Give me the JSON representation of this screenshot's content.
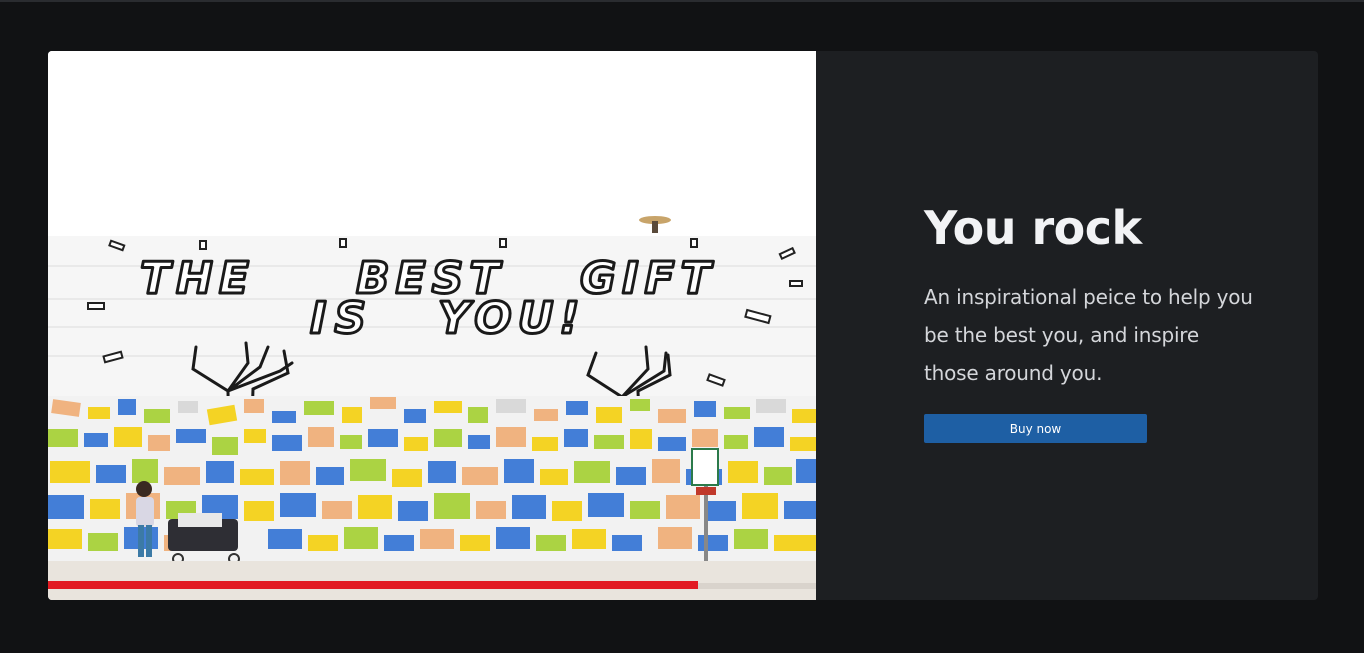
{
  "hero": {
    "image_alt": "Mural reading THE BEST GIFT IS YOU!",
    "mural_text": "THE BEST GIFT IS YOU!"
  },
  "content": {
    "title": "You rock",
    "description": "An inspirational peice to help you be the best you, and inspire those around you.",
    "button_label": "Buy now"
  },
  "colors": {
    "page_background": "#111214",
    "card_background": "#1d1f22",
    "button_background": "#1e5fa4"
  }
}
